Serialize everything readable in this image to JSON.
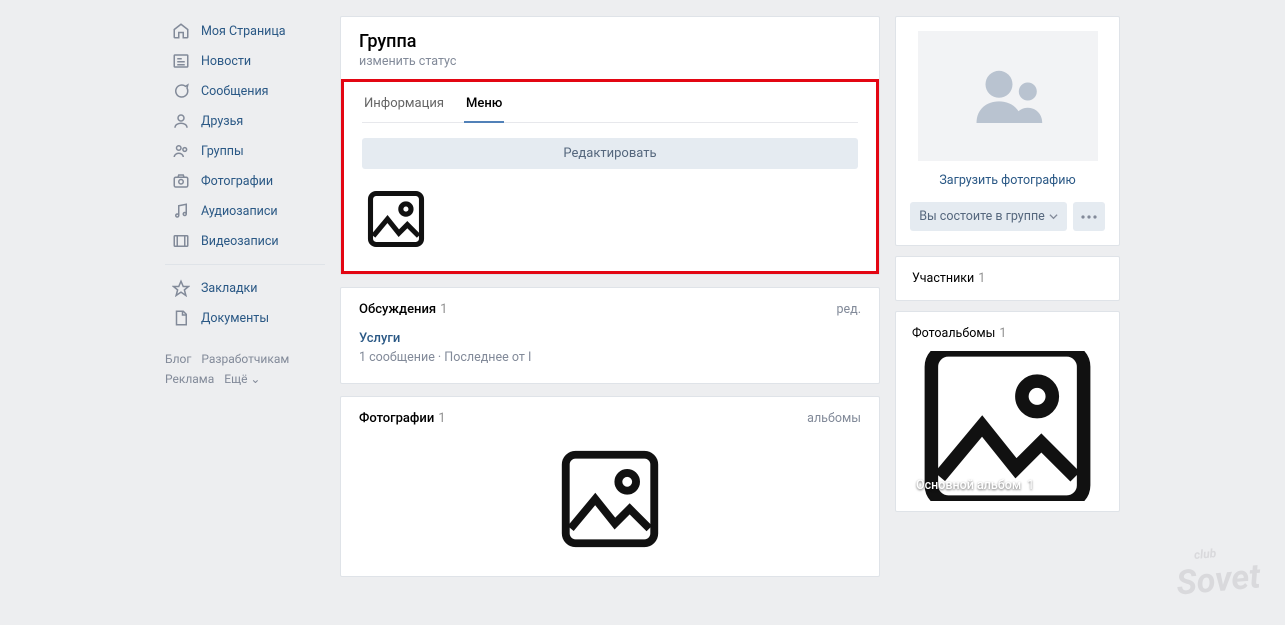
{
  "nav": {
    "items": [
      {
        "label": "Моя Страница"
      },
      {
        "label": "Новости"
      },
      {
        "label": "Сообщения"
      },
      {
        "label": "Друзья"
      },
      {
        "label": "Группы"
      },
      {
        "label": "Фотографии"
      },
      {
        "label": "Аудиозаписи"
      },
      {
        "label": "Видеозаписи"
      }
    ],
    "extra": [
      {
        "label": "Закладки"
      },
      {
        "label": "Документы"
      }
    ],
    "footer": {
      "blog": "Блог",
      "dev": "Разработчикам",
      "ads": "Реклама",
      "more": "Ещё ⌄"
    }
  },
  "group": {
    "title": "Группа",
    "status": "изменить статус",
    "tabs": {
      "info": "Информация",
      "menu": "Меню"
    },
    "edit": "Редактировать"
  },
  "discussions": {
    "title": "Обсуждения",
    "count": "1",
    "edit": "ред.",
    "topic": "Услуги",
    "meta": "1 сообщение  ·  Последнее от I"
  },
  "photos": {
    "title": "Фотографии",
    "count": "1",
    "link": "альбомы"
  },
  "side": {
    "upload": "Загрузить фотографию",
    "member": "Вы состоите в группе",
    "members": {
      "title": "Участники",
      "count": "1"
    },
    "albums": {
      "title": "Фотоальбомы",
      "count": "1",
      "name": "Основной альбом",
      "ncount": "1"
    }
  },
  "watermark": {
    "big": "Sovet",
    "small": "club"
  }
}
